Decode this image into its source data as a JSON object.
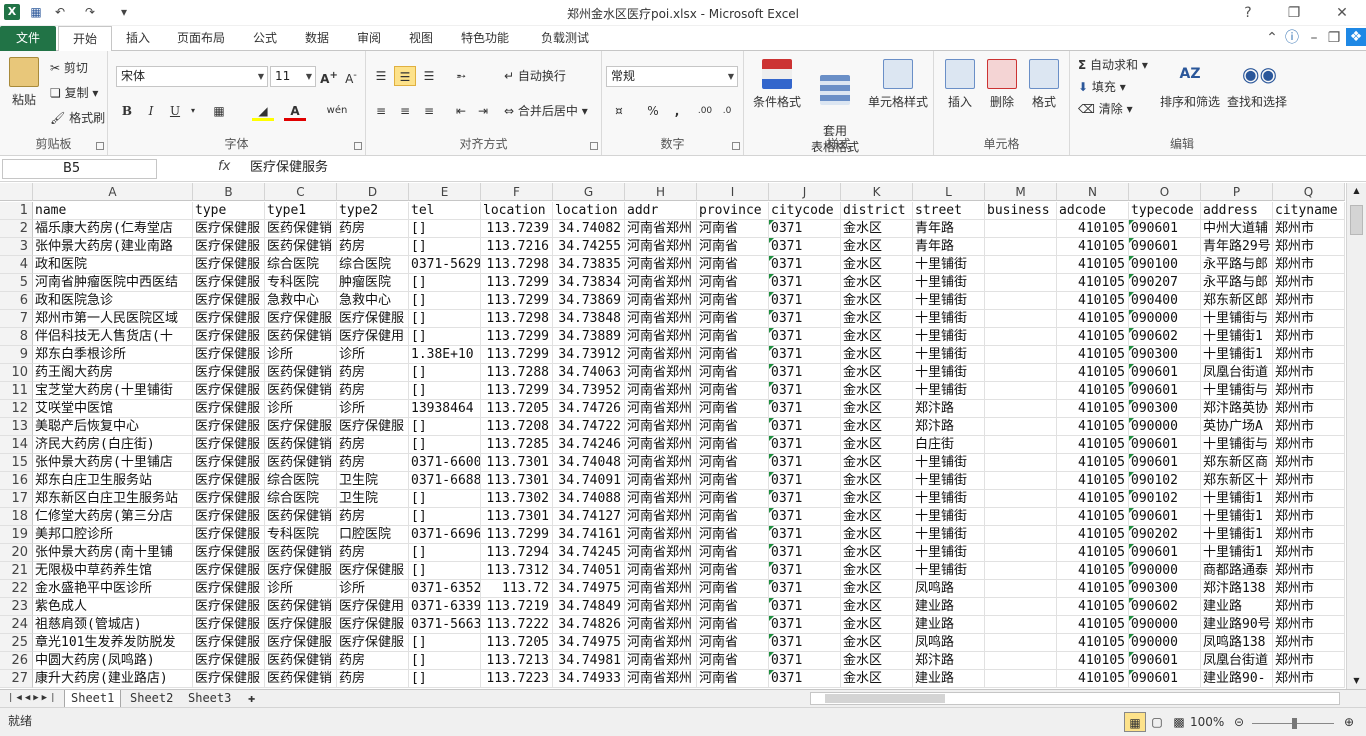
{
  "window": {
    "title": "郑州金水区医疗poi.xlsx - Microsoft Excel"
  },
  "tabs": [
    "文件",
    "开始",
    "插入",
    "页面布局",
    "公式",
    "数据",
    "审阅",
    "视图",
    "特色功能",
    "负载测试"
  ],
  "ribbon": {
    "clipboard": {
      "label": "剪贴板",
      "paste": "粘贴",
      "cut": "剪切",
      "copy": "复制",
      "painter": "格式刷"
    },
    "font": {
      "label": "字体",
      "name": "宋体",
      "size": "11",
      "bold": "B",
      "italic": "I",
      "underline": "U"
    },
    "align": {
      "label": "对齐方式",
      "wrap": "自动换行",
      "merge": "合并后居中"
    },
    "number": {
      "label": "数字",
      "format": "常规"
    },
    "styles": {
      "label": "样式",
      "cond": "条件格式",
      "table": "套用\n表格格式",
      "cellstyle": "单元格样式"
    },
    "cells": {
      "label": "单元格",
      "insert": "插入",
      "delete": "删除",
      "format": "格式"
    },
    "edit": {
      "label": "编辑",
      "autosum": "自动求和",
      "fill": "填充",
      "clear": "清除",
      "sort": "排序和筛选",
      "find": "查找和选择"
    }
  },
  "formula_bar": {
    "cell_ref": "B5",
    "fx": "fx",
    "value": "医疗保健服务"
  },
  "grid": {
    "columns": [
      "A",
      "B",
      "C",
      "D",
      "E",
      "F",
      "G",
      "H",
      "I",
      "J",
      "K",
      "L",
      "M",
      "N",
      "O",
      "P",
      "Q"
    ],
    "rows": [
      [
        "name",
        "type",
        "type1",
        "type2",
        "tel",
        "location",
        "location",
        "addr",
        "province",
        "citycode",
        "district",
        "street",
        "business",
        "adcode",
        "typecode",
        "address",
        "cityname"
      ],
      [
        "福乐康大药房(仁寿堂店",
        "医疗保健服",
        "医药保健销",
        "药房",
        "[]",
        "113.7239",
        "34.74082",
        "河南省郑州",
        "河南省",
        "0371",
        "金水区",
        "青年路",
        "",
        "410105",
        "090601",
        "中州大道辅",
        "郑州市"
      ],
      [
        "张仲景大药房(建业南路",
        "医疗保健服",
        "医药保健销",
        "药房",
        "[]",
        "113.7216",
        "34.74255",
        "河南省郑州",
        "河南省",
        "0371",
        "金水区",
        "青年路",
        "",
        "410105",
        "090601",
        "青年路29号",
        "郑州市"
      ],
      [
        "政和医院",
        "医疗保健服",
        "综合医院",
        "综合医院",
        "0371-5629",
        "113.7298",
        "34.73835",
        "河南省郑州",
        "河南省",
        "0371",
        "金水区",
        "十里铺街",
        "",
        "410105",
        "090100",
        "永平路与郎",
        "郑州市"
      ],
      [
        "河南省肿瘤医院中西医结",
        "医疗保健服",
        "专科医院",
        "肿瘤医院",
        "[]",
        "113.7299",
        "34.73834",
        "河南省郑州",
        "河南省",
        "0371",
        "金水区",
        "十里铺街",
        "",
        "410105",
        "090207",
        "永平路与郎",
        "郑州市"
      ],
      [
        "政和医院急诊",
        "医疗保健服",
        "急救中心",
        "急救中心",
        "[]",
        "113.7299",
        "34.73869",
        "河南省郑州",
        "河南省",
        "0371",
        "金水区",
        "十里铺街",
        "",
        "410105",
        "090400",
        "郑东新区郎",
        "郑州市"
      ],
      [
        "郑州市第一人民医院区域",
        "医疗保健服",
        "医疗保健服",
        "医疗保健服",
        "[]",
        "113.7298",
        "34.73848",
        "河南省郑州",
        "河南省",
        "0371",
        "金水区",
        "十里铺街",
        "",
        "410105",
        "090000",
        "十里铺街与",
        "郑州市"
      ],
      [
        "伴侣科技无人售货店(十",
        "医疗保健服",
        "医药保健销",
        "医疗保健用",
        "[]",
        "113.7299",
        "34.73889",
        "河南省郑州",
        "河南省",
        "0371",
        "金水区",
        "十里铺街",
        "",
        "410105",
        "090602",
        "十里铺街1",
        "郑州市"
      ],
      [
        "郑东白季根诊所",
        "医疗保健服",
        "诊所",
        "诊所",
        "1.38E+10",
        "113.7299",
        "34.73912",
        "河南省郑州",
        "河南省",
        "0371",
        "金水区",
        "十里铺街",
        "",
        "410105",
        "090300",
        "十里铺街1",
        "郑州市"
      ],
      [
        "药王阁大药房",
        "医疗保健服",
        "医药保健销",
        "药房",
        "[]",
        "113.7288",
        "34.74063",
        "河南省郑州",
        "河南省",
        "0371",
        "金水区",
        "十里铺街",
        "",
        "410105",
        "090601",
        "凤凰台街道",
        "郑州市"
      ],
      [
        "宝芝堂大药房(十里铺街",
        "医疗保健服",
        "医药保健销",
        "药房",
        "[]",
        "113.7299",
        "34.73952",
        "河南省郑州",
        "河南省",
        "0371",
        "金水区",
        "十里铺街",
        "",
        "410105",
        "090601",
        "十里铺街与",
        "郑州市"
      ],
      [
        "艾咲堂中医馆",
        "医疗保健服",
        "诊所",
        "诊所",
        "13938464",
        "113.7205",
        "34.74726",
        "河南省郑州",
        "河南省",
        "0371",
        "金水区",
        "郑汴路",
        "",
        "410105",
        "090300",
        "郑汴路英协",
        "郑州市"
      ],
      [
        "美聪产后恢复中心",
        "医疗保健服",
        "医疗保健服",
        "医疗保健服",
        "[]",
        "113.7208",
        "34.74722",
        "河南省郑州",
        "河南省",
        "0371",
        "金水区",
        "郑汴路",
        "",
        "410105",
        "090000",
        "英协广场A",
        "郑州市"
      ],
      [
        "济民大药房(白庄街)",
        "医疗保健服",
        "医药保健销",
        "药房",
        "[]",
        "113.7285",
        "34.74246",
        "河南省郑州",
        "河南省",
        "0371",
        "金水区",
        "白庄街",
        "",
        "410105",
        "090601",
        "十里铺街与",
        "郑州市"
      ],
      [
        "张仲景大药房(十里铺店",
        "医疗保健服",
        "医药保健销",
        "药房",
        "0371-6600",
        "113.7301",
        "34.74048",
        "河南省郑州",
        "河南省",
        "0371",
        "金水区",
        "十里铺街",
        "",
        "410105",
        "090601",
        "郑东新区商",
        "郑州市"
      ],
      [
        "郑东白庄卫生服务站",
        "医疗保健服",
        "综合医院",
        "卫生院",
        "0371-6688",
        "113.7301",
        "34.74091",
        "河南省郑州",
        "河南省",
        "0371",
        "金水区",
        "十里铺街",
        "",
        "410105",
        "090102",
        "郑东新区十",
        "郑州市"
      ],
      [
        "郑东新区白庄卫生服务站",
        "医疗保健服",
        "综合医院",
        "卫生院",
        "[]",
        "113.7302",
        "34.74088",
        "河南省郑州",
        "河南省",
        "0371",
        "金水区",
        "十里铺街",
        "",
        "410105",
        "090102",
        "十里铺街1",
        "郑州市"
      ],
      [
        "仁修堂大药房(第三分店",
        "医疗保健服",
        "医药保健销",
        "药房",
        "[]",
        "113.7301",
        "34.74127",
        "河南省郑州",
        "河南省",
        "0371",
        "金水区",
        "十里铺街",
        "",
        "410105",
        "090601",
        "十里铺街1",
        "郑州市"
      ],
      [
        "美邦口腔诊所",
        "医疗保健服",
        "专科医院",
        "口腔医院",
        "0371-6696",
        "113.7299",
        "34.74161",
        "河南省郑州",
        "河南省",
        "0371",
        "金水区",
        "十里铺街",
        "",
        "410105",
        "090202",
        "十里铺街1",
        "郑州市"
      ],
      [
        "张仲景大药房(南十里铺",
        "医疗保健服",
        "医药保健销",
        "药房",
        "[]",
        "113.7294",
        "34.74245",
        "河南省郑州",
        "河南省",
        "0371",
        "金水区",
        "十里铺街",
        "",
        "410105",
        "090601",
        "十里铺街1",
        "郑州市"
      ],
      [
        "无限极中草药养生馆",
        "医疗保健服",
        "医疗保健服",
        "医疗保健服",
        "[]",
        "113.7312",
        "34.74051",
        "河南省郑州",
        "河南省",
        "0371",
        "金水区",
        "十里铺街",
        "",
        "410105",
        "090000",
        "商都路通泰",
        "郑州市"
      ],
      [
        "金水盛艳平中医诊所",
        "医疗保健服",
        "诊所",
        "诊所",
        "0371-6352",
        "113.72",
        "34.74975",
        "河南省郑州",
        "河南省",
        "0371",
        "金水区",
        "凤鸣路",
        "",
        "410105",
        "090300",
        "郑汴路138",
        "郑州市"
      ],
      [
        "紫色成人",
        "医疗保健服",
        "医药保健销",
        "医疗保健用",
        "0371-6339",
        "113.7219",
        "34.74849",
        "河南省郑州",
        "河南省",
        "0371",
        "金水区",
        "建业路",
        "",
        "410105",
        "090602",
        "建业路",
        "郑州市"
      ],
      [
        "祖慈肩颈(管城店)",
        "医疗保健服",
        "医疗保健服",
        "医疗保健服",
        "0371-5663",
        "113.7222",
        "34.74826",
        "河南省郑州",
        "河南省",
        "0371",
        "金水区",
        "建业路",
        "",
        "410105",
        "090000",
        "建业路90号",
        "郑州市"
      ],
      [
        "章光101生发养发防脱发",
        "医疗保健服",
        "医疗保健服",
        "医疗保健服",
        "[]",
        "113.7205",
        "34.74975",
        "河南省郑州",
        "河南省",
        "0371",
        "金水区",
        "凤鸣路",
        "",
        "410105",
        "090000",
        "凤鸣路138",
        "郑州市"
      ],
      [
        "中圆大药房(凤鸣路)",
        "医疗保健服",
        "医药保健销",
        "药房",
        "[]",
        "113.7213",
        "34.74981",
        "河南省郑州",
        "河南省",
        "0371",
        "金水区",
        "郑汴路",
        "",
        "410105",
        "090601",
        "凤凰台街道",
        "郑州市"
      ],
      [
        "康升大药房(建业路店)",
        "医疗保健服",
        "医药保健销",
        "药房",
        "[]",
        "113.7223",
        "34.74933",
        "河南省郑州",
        "河南省",
        "0371",
        "金水区",
        "建业路",
        "",
        "410105",
        "090601",
        "建业路90-",
        "郑州市"
      ]
    ]
  },
  "sheets": [
    "Sheet1",
    "Sheet2",
    "Sheet3"
  ],
  "status": {
    "mode": "就绪",
    "zoom": "100%"
  }
}
